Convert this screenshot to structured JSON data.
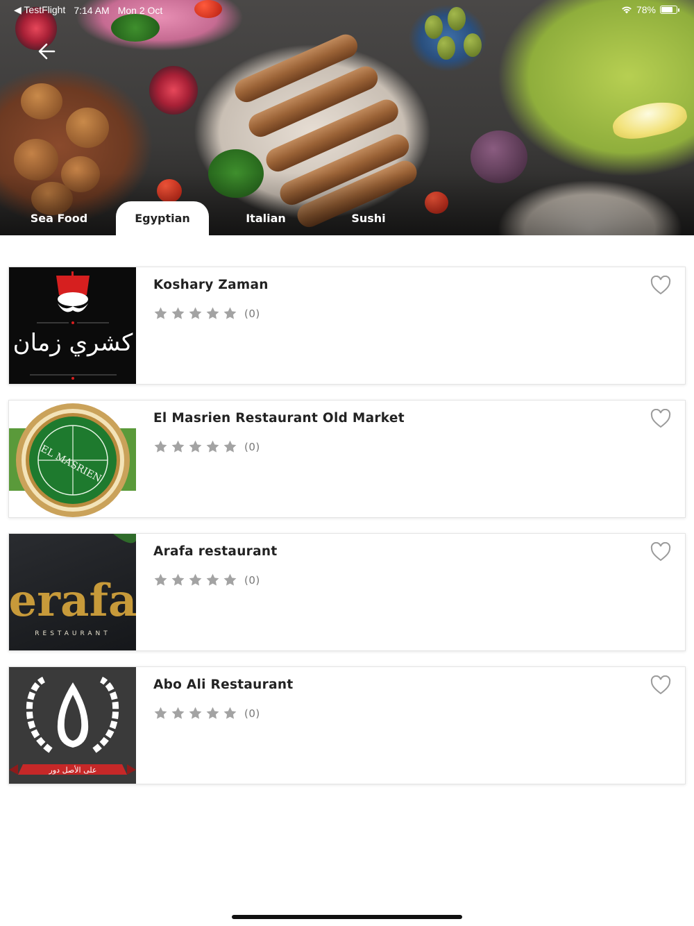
{
  "status_bar": {
    "back_app": "◀ TestFlight",
    "time": "7:14 AM",
    "date": "Mon 2 Oct",
    "battery": "78%",
    "battery_level": 0.78
  },
  "header": {
    "back_icon": "arrow-left-icon"
  },
  "tabs": [
    {
      "label": "Sea Food",
      "active": false
    },
    {
      "label": "Egyptian",
      "active": true
    },
    {
      "label": "Italian",
      "active": false
    },
    {
      "label": "Sushi",
      "active": false
    }
  ],
  "restaurants": [
    {
      "name": "Koshary Zaman",
      "rating": 0,
      "rating_count": "(0)",
      "favorite": false,
      "logo_text": "كشري زمان"
    },
    {
      "name": "El Masrien Restaurant Old Market",
      "rating": 0,
      "rating_count": "(0)",
      "favorite": false,
      "logo_text": "EL MASRIEN"
    },
    {
      "name": "Arafa restaurant",
      "rating": 0,
      "rating_count": "(0)",
      "favorite": false,
      "logo_text": "erafa",
      "logo_subtext": "RESTAURANT"
    },
    {
      "name": "Abo Ali Restaurant",
      "rating": 0,
      "rating_count": "(0)",
      "favorite": false,
      "logo_text": "على الأصل دور"
    }
  ],
  "colors": {
    "star": "#a3a3a3",
    "heart": "#9b9b9b",
    "active_tab_bg": "#ffffff",
    "tab_text": "#ffffff"
  }
}
